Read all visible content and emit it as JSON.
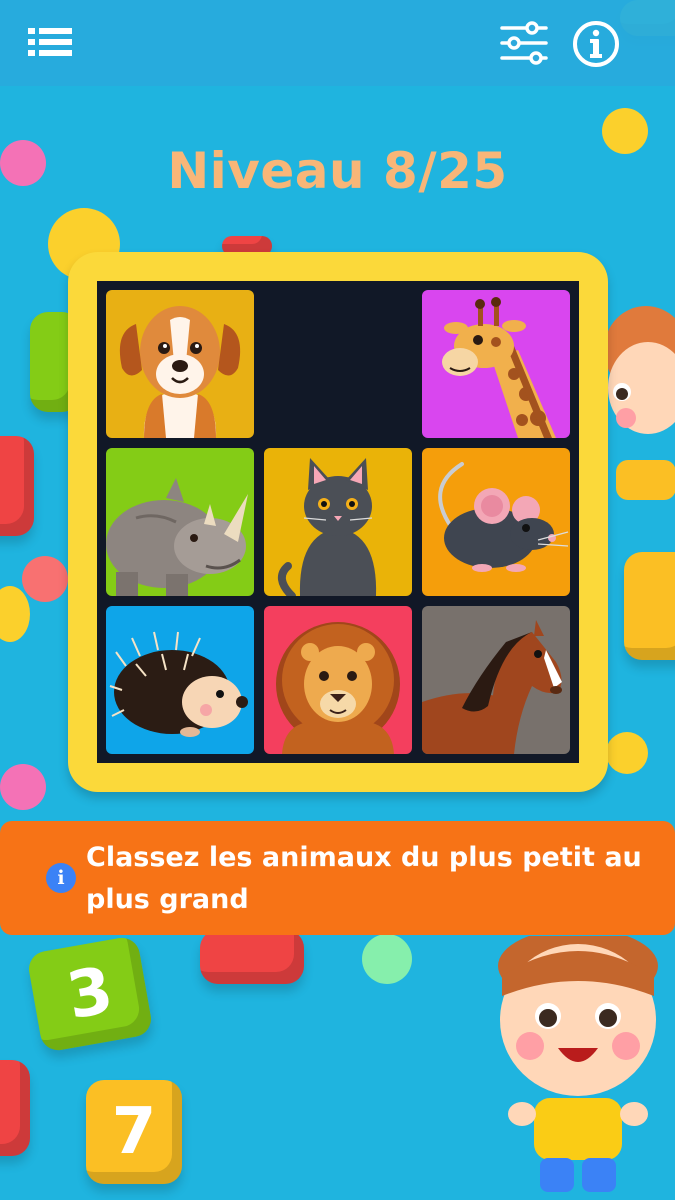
{
  "header": {
    "menu_icon": "list-menu-icon",
    "settings_icon": "sliders-settings-icon",
    "info_icon": "info-circle-icon"
  },
  "level": {
    "title": "Niveau 8/25",
    "current": 8,
    "total": 25
  },
  "puzzle": {
    "grid": "3x3",
    "empty_cell": {
      "row": 0,
      "col": 1
    },
    "tiles": [
      {
        "row": 0,
        "col": 0,
        "animal": "chien",
        "icon": "dog-icon",
        "bg": "#e8b014"
      },
      {
        "row": 0,
        "col": 2,
        "animal": "girafe",
        "icon": "giraffe-icon",
        "bg": "#d946ef"
      },
      {
        "row": 1,
        "col": 0,
        "animal": "rhinocéros",
        "icon": "rhino-icon",
        "bg": "#84cc16"
      },
      {
        "row": 1,
        "col": 1,
        "animal": "chat",
        "icon": "cat-icon",
        "bg": "#eab308"
      },
      {
        "row": 1,
        "col": 2,
        "animal": "souris",
        "icon": "mouse-icon",
        "bg": "#f59e0b"
      },
      {
        "row": 2,
        "col": 0,
        "animal": "hérisson",
        "icon": "hedgehog-icon",
        "bg": "#0ea5e9"
      },
      {
        "row": 2,
        "col": 1,
        "animal": "lion",
        "icon": "lion-icon",
        "bg": "#f43f5e"
      },
      {
        "row": 2,
        "col": 2,
        "animal": "cheval",
        "icon": "horse-icon",
        "bg": "#78716c"
      }
    ]
  },
  "instruction": {
    "icon": "info-icon",
    "text": "Classez les animaux du plus petit au plus grand"
  },
  "colors": {
    "background": "#1fb4df",
    "title": "#f8b678",
    "frame": "#fbd93a",
    "board": "#111827",
    "banner": "#f77316"
  }
}
